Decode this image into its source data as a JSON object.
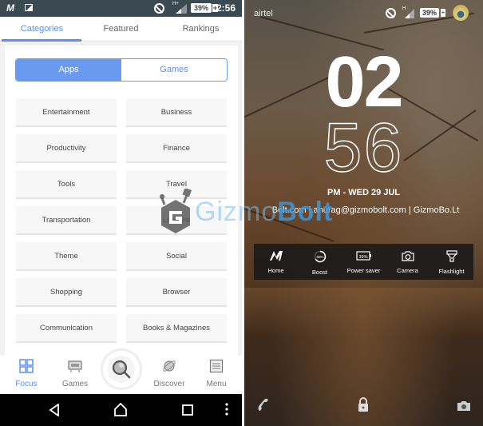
{
  "left_screen": {
    "status_bar": {
      "icons": [
        "app-m-icon",
        "image-icon",
        "do-not-disturb-icon",
        "signal-icon",
        "battery-icon"
      ],
      "network": "H+",
      "battery": "39%",
      "time": "2:56"
    },
    "tabs": [
      {
        "label": "Categories",
        "active": true
      },
      {
        "label": "Featured",
        "active": false
      },
      {
        "label": "Rankings",
        "active": false
      }
    ],
    "segment": {
      "apps_label": "Apps",
      "games_label": "Games",
      "selected": "Apps"
    },
    "categories": [
      "Entertainment",
      "Business",
      "Productivity",
      "Finance",
      "Tools",
      "Travel",
      "Transportation",
      "Lifestyle",
      "Theme",
      "Social",
      "Shopping",
      "Browser",
      "Communication",
      "Books & Magazines"
    ],
    "bottom_nav": [
      {
        "label": "Focus",
        "icon": "grid-icon",
        "active": true
      },
      {
        "label": "Games",
        "icon": "gamepad-icon",
        "active": false
      },
      {
        "label": "",
        "icon": "search-icon",
        "active": false
      },
      {
        "label": "Discover",
        "icon": "planet-icon",
        "active": false
      },
      {
        "label": "Menu",
        "icon": "menu-list-icon",
        "active": false
      }
    ],
    "system_nav": [
      "back-icon",
      "home-icon",
      "recents-icon",
      "more-icon"
    ]
  },
  "watermark": {
    "text_light": "Gizmo",
    "text_bold": "Bolt"
  },
  "right_screen": {
    "carrier": "airtel",
    "network": "H",
    "battery": "39%",
    "clock": {
      "hour": "02",
      "minute": "56",
      "date_line": "PM  -  WED 29 JUL"
    },
    "owner_info": "Bolt.com | anurag@gizmobolt.com | GizmoBo.Lt",
    "quick_actions": [
      {
        "label": "Home",
        "icon": "m-logo-icon"
      },
      {
        "label": "Boost",
        "icon": "boost-icon",
        "value": "68%"
      },
      {
        "label": "Power saver",
        "icon": "battery-saver-icon",
        "value": "39%"
      },
      {
        "label": "Camera",
        "icon": "camera-icon"
      },
      {
        "label": "Flashlight",
        "icon": "flashlight-icon"
      }
    ],
    "bottom_shortcuts": [
      "phone-icon",
      "lock-icon",
      "camera-icon"
    ]
  }
}
